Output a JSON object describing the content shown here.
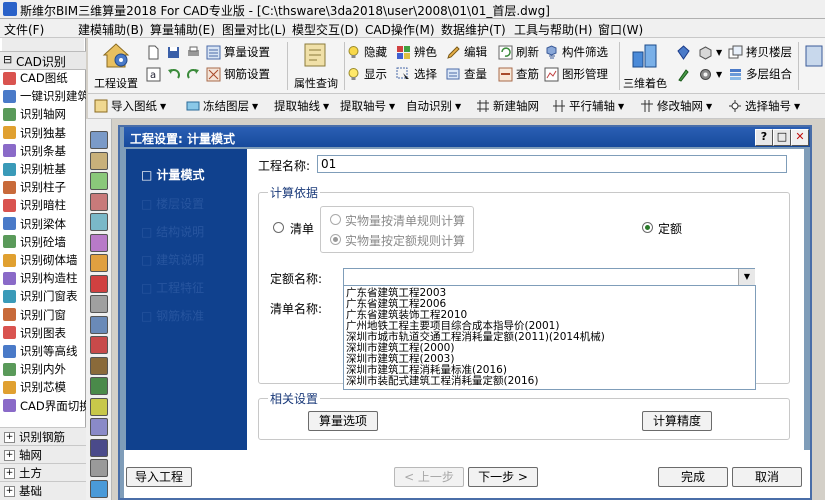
{
  "window": {
    "title": "斯维尔BIM三维算量2018 For CAD专业版 - [C:\\thsware\\3da2018\\user\\2008\\01\\01_首层.dwg]"
  },
  "menubar": [
    "文件(F)",
    "建模辅助(B)",
    "算量辅助(E)",
    "图量对比(L)",
    "模型交互(D)",
    "CAD操作(M)",
    "数据维护(T)",
    "工具与帮助(H)",
    "窗口(W)"
  ],
  "ribbon": {
    "project_settings": "工程设置",
    "calc_settings": "算量设置",
    "rebar_settings": "钢筋设置",
    "attr_query": "属性查询",
    "hide": "隐藏",
    "show": "显示",
    "color_distinguish": "辨色",
    "select": "选择",
    "edit": "编辑",
    "quantity_check": "查量",
    "refresh": "刷新",
    "rebar_check": "查筋",
    "component_filter": "构件筛选",
    "graphic_manage": "图形管理",
    "3d_color": "三维着色",
    "copy_floor": "拷贝楼层",
    "multi_floor": "多层组合"
  },
  "toolbar2": {
    "import_drawing": "导入图纸",
    "freeze_layer": "冻结图层",
    "extract_axis_line": "提取轴线",
    "extract_axis_number": "提取轴号",
    "auto_recognize": "自动识别",
    "new_axis_grid": "新建轴网",
    "parallel_aux": "平行辅轴",
    "modify_grid": "修改轴网",
    "select_axis_number": "选择轴号"
  },
  "leftpanel": {
    "header": "CAD识别",
    "items": [
      "CAD图纸",
      "一键识别建筑",
      "识别轴网",
      "识别独基",
      "识别条基",
      "识别桩基",
      "识别柱子",
      "识别暗柱",
      "识别梁体",
      "识别砼墙",
      "识别砌体墙",
      "识别构造柱",
      "识别门窗表",
      "识别门窗",
      "识别图表",
      "识别等高线",
      "识别内外",
      "识别芯模",
      "CAD界面切换"
    ],
    "categories": [
      "识别钢筋",
      "轴网",
      "土方",
      "基础"
    ]
  },
  "dialog": {
    "title": "工程设置: 计量模式",
    "nav": [
      "计量模式",
      "楼层设置",
      "结构说明",
      "建筑说明",
      "工程特征",
      "钢筋标准"
    ],
    "project_name_label": "工程名称:",
    "project_name_value": "01",
    "calc_basis_title": "计算依据",
    "radio_list": "清单",
    "radio_list_sub1": "实物量按清单规则计算",
    "radio_list_sub2": "实物量按定额规则计算",
    "radio_quota": "定额",
    "quota_name_label": "定额名称:",
    "quota_name_value": "",
    "list_name_label": "清单名称:",
    "quota_options": [
      "广东省建筑工程2003",
      "广东省建筑工程2006",
      "广东省建筑装饰工程2010",
      "广州地铁工程主要项目综合成本指导价(2001)",
      "深圳市城市轨道交通工程消耗量定额(2011)(2014机械)",
      "深圳市建筑工程(2000)",
      "深圳市建筑工程(2003)",
      "深圳市建筑工程消耗量标准(2016)",
      "深圳市装配式建筑工程消耗量定额(2016)"
    ],
    "related_settings_title": "相关设置",
    "calc_options_button": "算量选项",
    "calc_precision_button": "计算精度",
    "import_project_button": "导入工程",
    "prev_button": "< 上一步",
    "next_button": "下一步 >",
    "finish_button": "完成",
    "cancel_button": "取消"
  },
  "colors": {
    "nav_bg": "#10418e",
    "title_bar": "#1f55aa",
    "dialog_frame": "#7f9db9"
  }
}
